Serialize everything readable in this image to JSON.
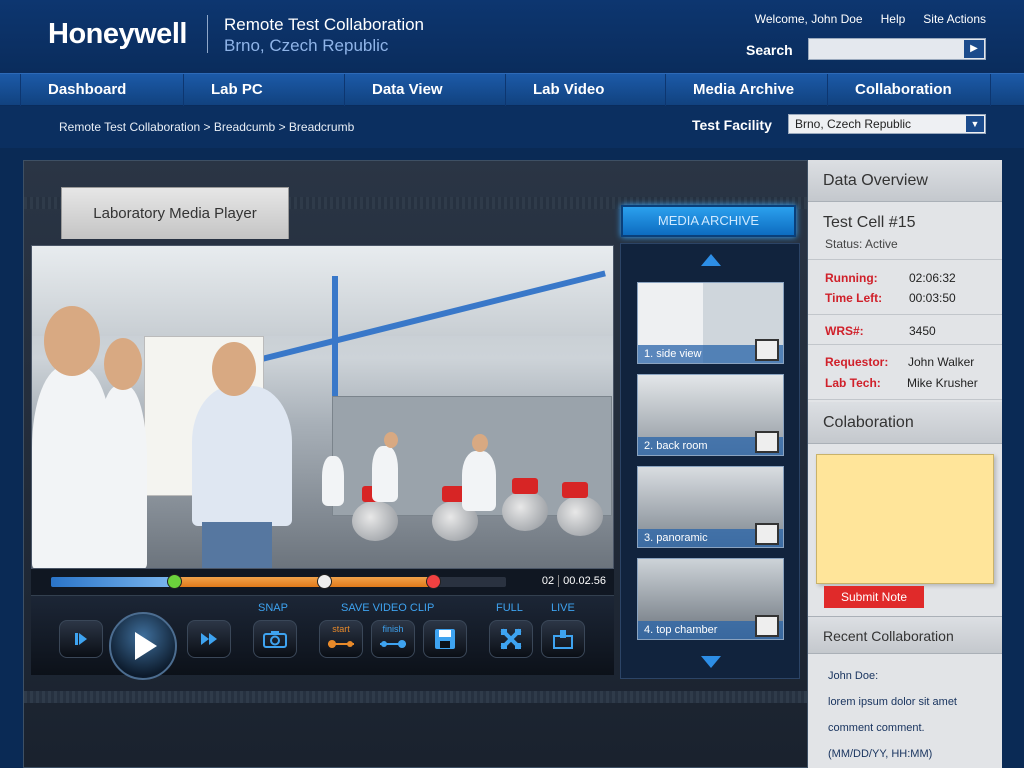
{
  "header": {
    "logo": "Honeywell",
    "title": "Remote Test Collaboration",
    "subtitle": "Brno, Czech Republic",
    "welcome": "Welcome, John Doe",
    "help": "Help",
    "site_actions": "Site Actions",
    "search_label": "Search",
    "search_value": ""
  },
  "nav": {
    "items": [
      {
        "label": "Dashboard"
      },
      {
        "label": "Lab PC"
      },
      {
        "label": "Data View"
      },
      {
        "label": "Lab Video"
      },
      {
        "label": "Media Archive"
      },
      {
        "label": "Collaboration"
      }
    ]
  },
  "crumbs": {
    "text": "Remote Test Collaboration > Breadcumb > Breadcrumb",
    "facility_label": "Test Facility",
    "facility_value": "Brno, Czech Republic"
  },
  "player": {
    "tab_label": "Laboratory Media Player",
    "media_archive": "MEDIA ARCHIVE",
    "time_index": "02",
    "timecode": "00.02.56",
    "played_fraction": 0.27,
    "clip_end_fraction": 0.84,
    "scrub_fraction": 0.6,
    "controls": {
      "snap": "SNAP",
      "save_clip": "SAVE VIDEO CLIP",
      "full": "FULL",
      "live": "LIVE",
      "start": "start",
      "finish": "finish"
    },
    "thumbs": [
      {
        "caption": "1. side view"
      },
      {
        "caption": "2. back room"
      },
      {
        "caption": "3. panoramic"
      },
      {
        "caption": "4. top chamber"
      }
    ]
  },
  "overview": {
    "title": "Data Overview",
    "cell": "Test Cell #15",
    "status": "Status: Active",
    "running_label": "Running:",
    "running_value": "02:06:32",
    "timeleft_label": "Time Left:",
    "timeleft_value": "00:03:50",
    "wrs_label": "WRS#:",
    "wrs_value": "3450",
    "requestor_label": "Requestor:",
    "requestor_value": "John Walker",
    "labtech_label": "Lab Tech:",
    "labtech_value": "Mike Krusher"
  },
  "collab": {
    "title": "Colaboration",
    "note_value": "",
    "submit": "Submit Note",
    "recent_title": "Recent Collaboration",
    "recent_lines": [
      "John Doe:",
      "lorem ipsum dolor sit amet",
      "comment comment.",
      "(MM/DD/YY, HH:MM)"
    ]
  }
}
